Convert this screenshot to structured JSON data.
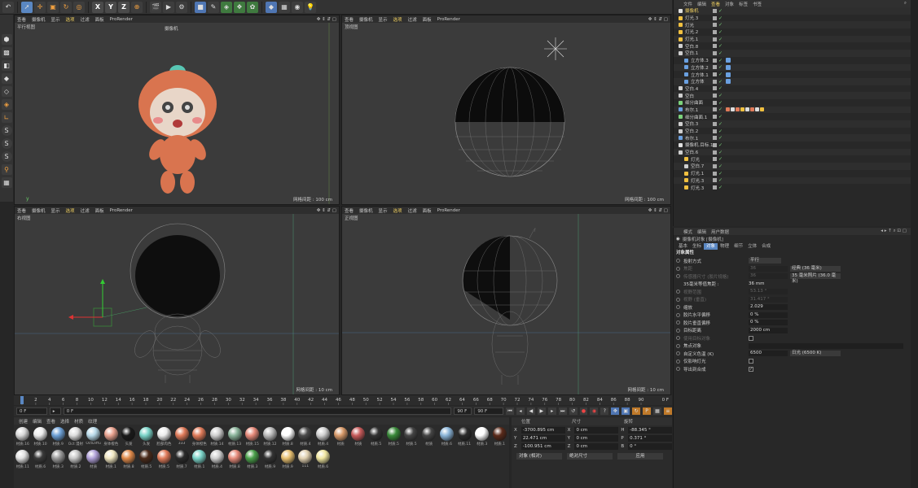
{
  "toolbar": {
    "axes": [
      "X",
      "Y",
      "Z"
    ],
    "icons": [
      "undo-icon",
      "pointer-icon",
      "move-icon",
      "scale-icon",
      "rotate-icon",
      "recent-icon",
      "axis-x",
      "axis-y",
      "axis-z",
      "coord-system-icon",
      "render-view-icon",
      "render-icon",
      "render-settings-icon",
      "cube-icon",
      "pen-icon",
      "subdivision-icon",
      "cloner-icon",
      "deformer-icon",
      "scene-icon",
      "camera-icon",
      "light-icon"
    ]
  },
  "viewports": [
    {
      "label": "平行视图",
      "menu": [
        "查看",
        "摄像机",
        "显示",
        "选项",
        "过滤",
        "面板",
        "ProRender"
      ],
      "camera": "摄像机",
      "grid": "网格间距 : 100 cm"
    },
    {
      "label": "顶视图",
      "menu": [
        "查看",
        "摄像机",
        "显示",
        "选项",
        "过滤",
        "面板",
        "ProRender"
      ],
      "grid": "网格间距 : 100 cm"
    },
    {
      "label": "右视图",
      "menu": [
        "查看",
        "摄像机",
        "显示",
        "选项",
        "过滤",
        "面板",
        "ProRender"
      ],
      "grid": "网格间距 : 10 cm"
    },
    {
      "label": "正视图",
      "menu": [
        "查看",
        "摄像机",
        "显示",
        "选项",
        "过滤",
        "面板",
        "ProRender"
      ],
      "grid": "网格间距 : 10 cm"
    }
  ],
  "timeline": {
    "ticks": [
      "0",
      "2",
      "4",
      "6",
      "8",
      "10",
      "12",
      "14",
      "16",
      "18",
      "20",
      "22",
      "24",
      "26",
      "28",
      "30",
      "32",
      "34",
      "36",
      "38",
      "40",
      "42",
      "44",
      "46",
      "48",
      "50",
      "52",
      "54",
      "56",
      "58",
      "60",
      "62",
      "64",
      "66",
      "68",
      "70",
      "72",
      "74",
      "76",
      "78",
      "80",
      "82",
      "84",
      "86",
      "88",
      "90"
    ],
    "end_label": "0 F",
    "start_field": "0 F",
    "current_field": "0 F",
    "max_field": "90 F",
    "end_field": "90 F",
    "current_frame": 0
  },
  "material_manager": {
    "menu": [
      "创建",
      "编辑",
      "查看",
      "选择",
      "材质",
      "纹理"
    ],
    "materials": [
      {
        "name": "材质.16",
        "color": "#d8d8d8"
      },
      {
        "name": "材质.10",
        "color": "#ececec"
      },
      {
        "name": "材质.9",
        "color": "#6da0d6"
      },
      {
        "name": "Oct 漫射",
        "color": "#dddddd"
      },
      {
        "name": "OctDiffu",
        "color": "#b8d9e8"
      },
      {
        "name": "身体橙色",
        "color": "#e9a28f"
      },
      {
        "name": "头发",
        "color": "#1a1a1a"
      },
      {
        "name": "头发",
        "color": "#7ad3c8"
      },
      {
        "name": "脸部肉色",
        "color": "#ececec"
      },
      {
        "name": "333",
        "color": "#e07b5a"
      },
      {
        "name": "身体橙色",
        "color": "#e07b5a"
      },
      {
        "name": "材质.14",
        "color": "#cfcfcf"
      },
      {
        "name": "材质.13",
        "color": "#8ab39a"
      },
      {
        "name": "材质.15",
        "color": "#e68a7a"
      },
      {
        "name": "材质.12",
        "color": "#b9b9b9"
      },
      {
        "name": "材质.8",
        "color": "#ffffff"
      },
      {
        "name": "材质.4",
        "color": "#4a4a4a"
      },
      {
        "name": "材质.4",
        "color": "#d0d0d0"
      },
      {
        "name": "材质",
        "color": "#d89a6a"
      },
      {
        "name": "材质",
        "color": "#c75a5a"
      },
      {
        "name": "材质.5",
        "color": "#333333"
      },
      {
        "name": "材质.5",
        "color": "#3a8a3a"
      },
      {
        "name": "材质.5",
        "color": "#444444"
      },
      {
        "name": "材质",
        "color": "#444444"
      },
      {
        "name": "材质.6",
        "color": "#8ab4d8"
      },
      {
        "name": "材质.11",
        "color": "#2a2a2a"
      },
      {
        "name": "材质.3",
        "color": "#ffffff"
      },
      {
        "name": "材质.1",
        "color": "#5a2a1a"
      },
      {
        "name": "材质.11",
        "color": "#e0e0e0"
      },
      {
        "name": "材质.6",
        "color": "#3a3a3a"
      },
      {
        "name": "材质.3",
        "color": "#9a9a9a"
      },
      {
        "name": "材质.2",
        "color": "#c8c8c8"
      },
      {
        "name": "材质",
        "color": "#b0a0d8"
      },
      {
        "name": "材质.1",
        "color": "#f0e6c0"
      },
      {
        "name": "材质.8",
        "color": "#e08a4a"
      },
      {
        "name": "材质.5",
        "color": "#4a2a1a"
      },
      {
        "name": "材质.5",
        "color": "#e07b5a"
      },
      {
        "name": "材质.7",
        "color": "#2a2a2a"
      },
      {
        "name": "材质.1",
        "color": "#7ad3c8"
      },
      {
        "name": "材质.4",
        "color": "#d0d0d0"
      },
      {
        "name": "材质.8",
        "color": "#e68a7a"
      },
      {
        "name": "材质.3",
        "color": "#4aa04a"
      },
      {
        "name": "材质.9",
        "color": "#333333"
      },
      {
        "name": "材质.9",
        "color": "#e8c070"
      },
      {
        "name": "111",
        "color": "#e0d0b0"
      },
      {
        "name": "材质.6",
        "color": "#f0e6a0"
      }
    ]
  },
  "coordinates": {
    "headers": [
      "位置",
      "尺寸",
      "旋转"
    ],
    "rows": [
      {
        "axis": "X",
        "pos": "-3700.895 cm",
        "size_axis": "X",
        "size": "0 cm",
        "rot_axis": "H",
        "rot": "-88.345 °"
      },
      {
        "axis": "Y",
        "pos": "22.471 cm",
        "size_axis": "Y",
        "size": "0 cm",
        "rot_axis": "P",
        "rot": "0.371 °"
      },
      {
        "axis": "Z",
        "pos": "-100.951 cm",
        "size_axis": "Z",
        "size": "0 cm",
        "rot_axis": "B",
        "rot": "0 °"
      }
    ],
    "mode": "对象 (相对)",
    "size_mode": "绝对尺寸",
    "apply": "应用"
  },
  "object_manager": {
    "menu": [
      "文件",
      "编辑",
      "查看",
      "对象",
      "标签",
      "书签"
    ],
    "objects": [
      {
        "name": "摄像机",
        "indent": 0,
        "color": "#e0e0e0",
        "active": true
      },
      {
        "name": "灯光.3",
        "indent": 0,
        "color": "#f0c040"
      },
      {
        "name": "灯光",
        "indent": 0,
        "color": "#f0c040"
      },
      {
        "name": "灯光.2",
        "indent": 0,
        "color": "#f0c040"
      },
      {
        "name": "灯光.1",
        "indent": 0,
        "color": "#f0c040"
      },
      {
        "name": "空白.8",
        "indent": 0,
        "color": "#cfcfcf"
      },
      {
        "name": "空白.1",
        "indent": 0,
        "color": "#cfcfcf"
      },
      {
        "name": "立方体.3",
        "indent": 1,
        "color": "#6aa0e0",
        "tag": true
      },
      {
        "name": "立方体.2",
        "indent": 1,
        "color": "#6aa0e0",
        "tag": true
      },
      {
        "name": "立方体.1",
        "indent": 1,
        "color": "#6aa0e0",
        "tag": true
      },
      {
        "name": "立方体",
        "indent": 1,
        "color": "#6aa0e0",
        "tag": true
      },
      {
        "name": "空白.4",
        "indent": 0,
        "color": "#cfcfcf"
      },
      {
        "name": "空白",
        "indent": 0,
        "color": "#cfcfcf"
      },
      {
        "name": "细分曲面",
        "indent": 0,
        "color": "#7bd27b"
      },
      {
        "name": "布尔.1",
        "indent": 0,
        "color": "#6aa0e0",
        "tags": true
      },
      {
        "name": "细分曲面.1",
        "indent": 0,
        "color": "#7bd27b"
      },
      {
        "name": "空白.3",
        "indent": 0,
        "color": "#cfcfcf"
      },
      {
        "name": "空白.2",
        "indent": 0,
        "color": "#cfcfcf"
      },
      {
        "name": "布尔.1",
        "indent": 0,
        "color": "#6aa0e0"
      },
      {
        "name": "摄像机.目标.1",
        "indent": 0,
        "color": "#e0e0e0"
      },
      {
        "name": "空白.6",
        "indent": 0,
        "color": "#cfcfcf"
      },
      {
        "name": "灯光",
        "indent": 1,
        "color": "#f0c040"
      },
      {
        "name": "空白.7",
        "indent": 1,
        "color": "#cfcfcf"
      },
      {
        "name": "灯光.1",
        "indent": 1,
        "color": "#f0c040"
      },
      {
        "name": "灯光.3",
        "indent": 1,
        "color": "#f0c040"
      },
      {
        "name": "灯光.3",
        "indent": 1,
        "color": "#f0c040"
      }
    ]
  },
  "attribute_manager": {
    "menu": [
      "模式",
      "编辑",
      "用户数据"
    ],
    "title": "摄像机对象 [摄像机]",
    "tabs": [
      "基本",
      "坐标",
      "对象",
      "物理",
      "细节",
      "立体",
      "合成"
    ],
    "active_tab": "对象",
    "section": "对象属性",
    "rows": [
      {
        "label": "投射方式",
        "value": "平行",
        "type": "dd",
        "dim": false
      },
      {
        "label": "焦距",
        "value": "36",
        "type": "val",
        "dim": true,
        "extra": "经典 (36 毫米)"
      },
      {
        "label": "传感器尺寸 (胶片规格)",
        "value": "36",
        "type": "val",
        "dim": true,
        "extra": "35 毫米照片 (36.0 毫米)"
      },
      {
        "label": "35毫米等值焦距 :",
        "value": "36 mm",
        "type": "text",
        "dim": false
      },
      {
        "label": "视野范围",
        "value": "53.13 °",
        "type": "val",
        "dim": true
      },
      {
        "label": "视野 (垂直)",
        "value": "31.417 °",
        "type": "val",
        "dim": true
      },
      {
        "label": "缩放",
        "value": "2.029",
        "type": "val",
        "dim": false
      },
      {
        "label": "胶片水平偏移",
        "value": "0 %",
        "type": "val",
        "dim": false
      },
      {
        "label": "胶片垂直偏移",
        "value": "0 %",
        "type": "val",
        "dim": false
      },
      {
        "label": "目标距离",
        "value": "2000 cm",
        "type": "val",
        "dim": false
      },
      {
        "label": "使用目标对象",
        "value": "",
        "type": "cb",
        "dim": true
      },
      {
        "label": "焦点对象",
        "value": "",
        "type": "link",
        "dim": false
      },
      {
        "label": "自定义色温 (K)",
        "value": "6500",
        "type": "val",
        "dim": false,
        "extra": "日光 (6500 K)"
      },
      {
        "label": "仅影响灯光",
        "value": "",
        "type": "cb",
        "dim": false
      },
      {
        "label": "导出到合成",
        "value": "✓",
        "type": "cb",
        "dim": false
      }
    ]
  }
}
